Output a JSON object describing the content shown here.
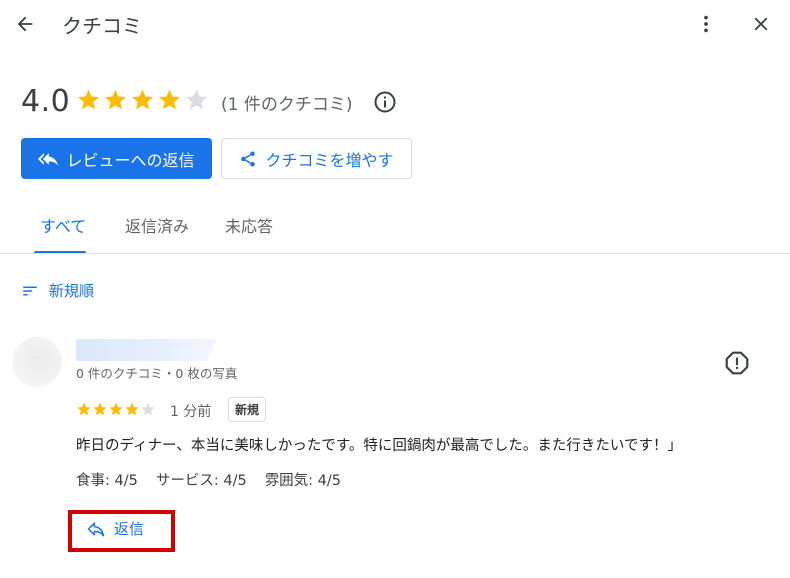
{
  "header": {
    "title": "クチコミ"
  },
  "summary": {
    "rating": "4.0",
    "stars_filled": 4,
    "stars_total": 5,
    "review_count_text": "(1 件のクチコミ)"
  },
  "actions": {
    "reply_reviews_label": "レビューへの返信",
    "get_more_reviews_label": "クチコミを増やす"
  },
  "tabs": [
    {
      "label": "すべて",
      "active": true
    },
    {
      "label": "返信済み",
      "active": false
    },
    {
      "label": "未応答",
      "active": false
    }
  ],
  "sort": {
    "label": "新規順"
  },
  "review": {
    "meta": "0 件のクチコミ・0 枚の写真",
    "stars_filled": 4,
    "time": "1 分前",
    "badge": "新規",
    "text": "昨日のディナー、本当に美味しかったです。特に回鍋肉が最高でした。また行きたいです！」",
    "subratings": [
      "食事: 4/5",
      "サービス: 4/5",
      "雰囲気: 4/5"
    ],
    "reply_label": "返信"
  },
  "colors": {
    "accent": "#1a73e8",
    "star_filled": "#fbbc04",
    "star_empty": "#dadce0",
    "highlight": "#d40000"
  },
  "icons": {
    "back": "arrow-back-icon",
    "more": "more-vert-icon",
    "close": "close-icon",
    "info": "info-icon",
    "reply": "reply-all-icon",
    "share": "share-icon",
    "sort": "sort-icon",
    "report": "report-icon",
    "reply_single": "reply-icon"
  }
}
